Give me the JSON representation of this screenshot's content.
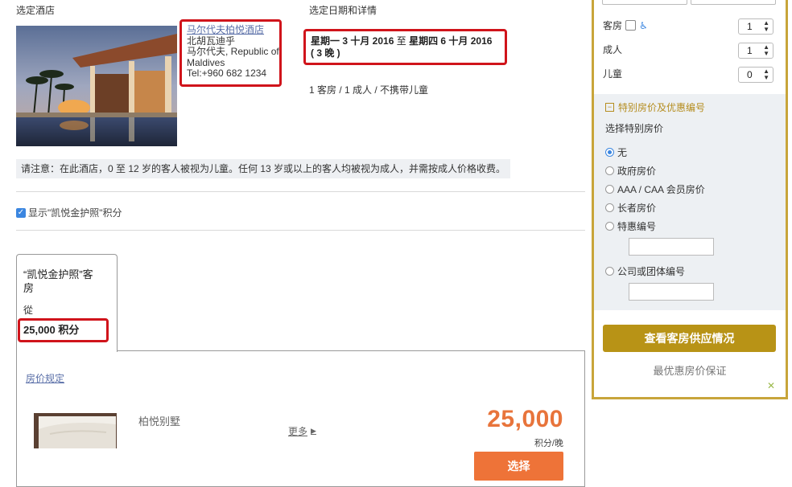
{
  "selected_hotel": {
    "section_title": "选定酒店",
    "name": "马尔代夫柏悦酒店",
    "address_line1": "北胡瓦迪乎",
    "address_line2": "马尔代夫, Republic of",
    "address_line3": "Maldives",
    "phone": "Tel:+960 682 1234"
  },
  "dates": {
    "section_title": "选定日期和详情",
    "checkin": "星期一 3 十月 2016",
    "to": "至",
    "checkout": "星期四 6 十月 2016",
    "nights": "( 3 晚 )",
    "summary": "1 客房 / 1 成人 / 不携带儿童"
  },
  "notice": "请注意：在此酒店，0 至 12 岁的客人被视为儿童。任何 13 岁或以上的客人均被视为成人，并需按成人价格收费。",
  "show_points_label": "显示\"凯悦金护照\"积分",
  "points_tab": {
    "title_line1": "“凯悦金护照”客",
    "title_line2": "房",
    "from": "從",
    "points": "25,000 积分"
  },
  "room": {
    "rate_rules": "房价规定",
    "name": "柏悦别墅",
    "more": "更多",
    "price": "25,000",
    "unit": "积分/晚",
    "select": "选择"
  },
  "sidebar": {
    "rooms_label": "客房",
    "rooms_value": "1",
    "adults_label": "成人",
    "adults_value": "1",
    "children_label": "儿童",
    "children_value": "0",
    "accessibility_icon": "wheelchair-icon",
    "special_title": "特别房价及优惠编号",
    "choose_rate": "选择特别房价",
    "rate_options": [
      "无",
      "政府房价",
      "AAA / CAA 会员房价",
      "长者房价",
      "特惠编号"
    ],
    "corporate": "公司或团体编号",
    "check_button": "查看客房供应情况",
    "guarantee": "最优惠房价保证",
    "close": "✕"
  },
  "colors": {
    "highlight_red": "#d0141b",
    "accent_gold": "#b89316",
    "price_orange": "#e8743b",
    "button_orange": "#ee7338",
    "link_blue": "#5a6fa8"
  }
}
